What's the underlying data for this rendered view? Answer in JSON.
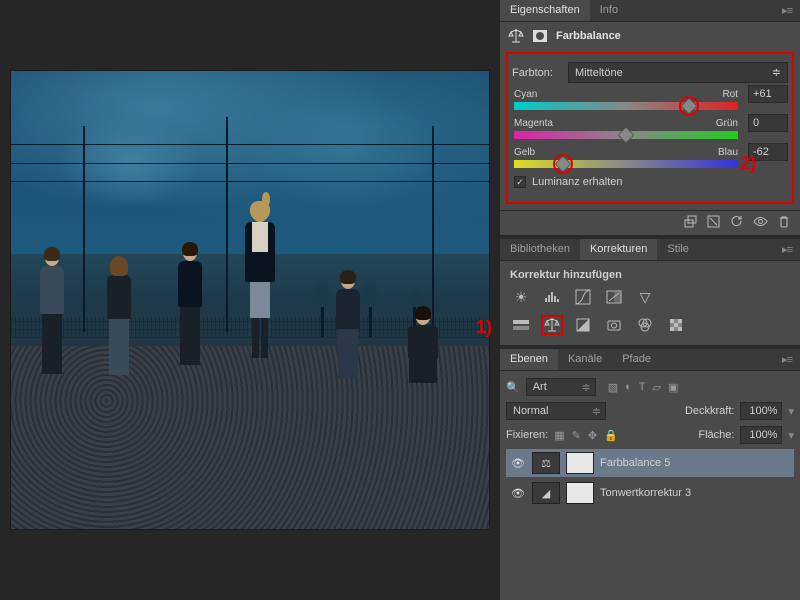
{
  "panels": {
    "properties": {
      "tab_properties": "Eigenschaften",
      "tab_info": "Info",
      "title": "Farbbalance"
    },
    "tone": {
      "label": "Farbton:",
      "selected": "Mitteltöne"
    },
    "sliders": {
      "cyan_label": "Cyan",
      "rot_label": "Rot",
      "red_value": "+61",
      "magenta_label": "Magenta",
      "gruen_label": "Grün",
      "green_value": "0",
      "gelb_label": "Gelb",
      "blau_label": "Blau",
      "blue_value": "-62"
    },
    "luminance": {
      "label": "Luminanz erhalten",
      "checked": true
    },
    "annotations": {
      "one": "1)",
      "two": "2)"
    },
    "adjustments": {
      "tab_lib": "Bibliotheken",
      "tab_korr": "Korrekturen",
      "tab_stile": "Stile",
      "add_label": "Korrektur hinzufügen"
    },
    "layers": {
      "tab_ebenen": "Ebenen",
      "tab_kanaele": "Kanäle",
      "tab_pfade": "Pfade",
      "filter": "Art",
      "blend": "Normal",
      "opacity_label": "Deckkraft:",
      "opacity_value": "100%",
      "fix_label": "Fixieren:",
      "fill_label": "Fläche:",
      "fill_value": "100%",
      "layer1": "Farbbalance 5",
      "layer2": "Tonwertkorrektur 3"
    }
  }
}
